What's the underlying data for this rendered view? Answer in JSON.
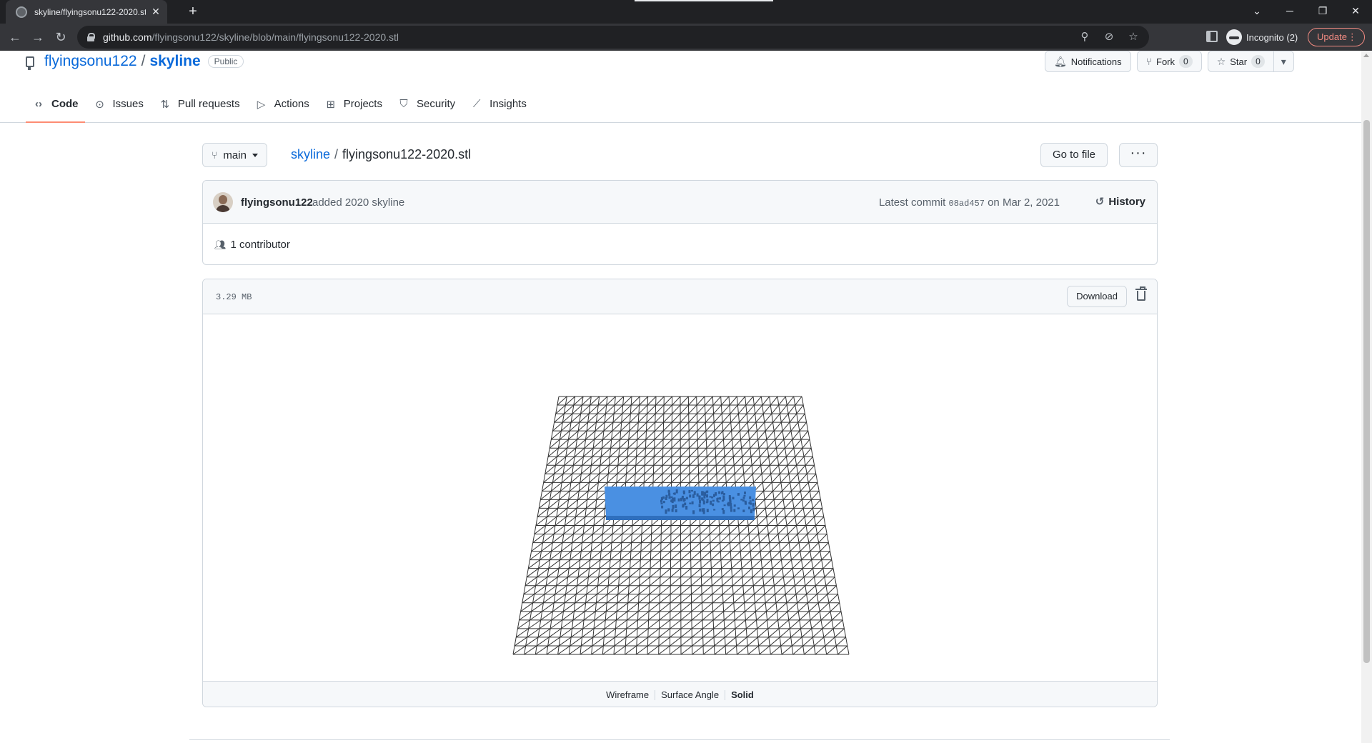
{
  "browser": {
    "tab_title": "skyline/flyingsonu122-2020.stl at",
    "url_host": "github.com",
    "url_path": "/flyingsonu122/skyline/blob/main/flyingsonu122-2020.stl",
    "incognito_label": "Incognito (2)",
    "update_label": "Update"
  },
  "repo": {
    "owner": "flyingsonu122",
    "separator": "/",
    "name": "skyline",
    "visibility": "Public",
    "notifications_label": "Notifications",
    "fork_label": "Fork",
    "fork_count": "0",
    "star_label": "Star",
    "star_count": "0"
  },
  "tabs": [
    {
      "label": "Code",
      "icon": "code-icon"
    },
    {
      "label": "Issues",
      "icon": "issue-icon"
    },
    {
      "label": "Pull requests",
      "icon": "pull-request-icon"
    },
    {
      "label": "Actions",
      "icon": "play-icon"
    },
    {
      "label": "Projects",
      "icon": "table-icon"
    },
    {
      "label": "Security",
      "icon": "shield-icon"
    },
    {
      "label": "Insights",
      "icon": "graph-icon"
    }
  ],
  "file_nav": {
    "branch": "main",
    "crumb_repo": "skyline",
    "crumb_sep": "/",
    "crumb_file": "flyingsonu122-2020.stl",
    "goto_label": "Go to file",
    "more_label": "···"
  },
  "commit": {
    "author": "flyingsonu122",
    "message": "added 2020 skyline",
    "latest_prefix": "Latest commit",
    "sha": "08ad457",
    "date": "on Mar 2, 2021",
    "history_label": "History",
    "contributors": "1 contributor"
  },
  "file": {
    "size": "3.29 MB",
    "download_label": "Download",
    "modes": [
      "Wireframe",
      "Surface Angle",
      "Solid"
    ],
    "active_mode": "Solid"
  },
  "colors": {
    "link": "#0969da",
    "model_fill": "#4a90e2",
    "tab_underline": "#fd8c73"
  }
}
